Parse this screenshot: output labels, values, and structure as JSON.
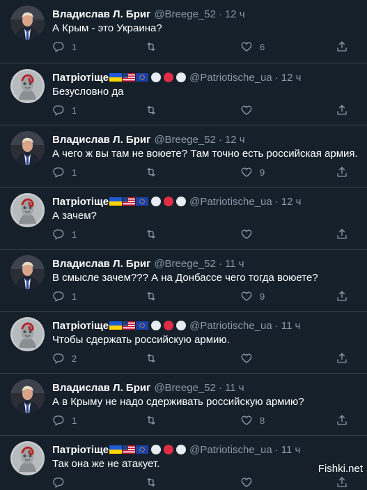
{
  "colors": {
    "background": "#15202b",
    "muted": "#8899a6",
    "divider": "#38444d"
  },
  "tweets": [
    {
      "name": "Владислав Л. Бриг",
      "handle": "@Breege_52",
      "sep": "·",
      "time": "12 ч",
      "text": "А Крым - это Украина?",
      "reply_count": "1",
      "retweet_count": "",
      "like_count": "6",
      "author": "vlad"
    },
    {
      "name": "Патріотіще",
      "handle": "@Patriotische_ua",
      "sep": "·",
      "time": "12 ч",
      "text": "Безусловно да",
      "reply_count": "1",
      "retweet_count": "",
      "like_count": "",
      "author": "patriot"
    },
    {
      "name": "Владислав Л. Бриг",
      "handle": "@Breege_52",
      "sep": "·",
      "time": "12 ч",
      "text": "А чего ж вы там не воюете? Там точно есть российская армия.",
      "reply_count": "1",
      "retweet_count": "",
      "like_count": "9",
      "author": "vlad"
    },
    {
      "name": "Патріотіще",
      "handle": "@Patriotische_ua",
      "sep": "·",
      "time": "12 ч",
      "text": "А зачем?",
      "reply_count": "1",
      "retweet_count": "",
      "like_count": "",
      "author": "patriot"
    },
    {
      "name": "Владислав Л. Бриг",
      "handle": "@Breege_52",
      "sep": "·",
      "time": "11 ч",
      "text": "В смысле зачем??? А на Донбассе чего тогда воюете?",
      "reply_count": "1",
      "retweet_count": "",
      "like_count": "9",
      "author": "vlad"
    },
    {
      "name": "Патріотіще",
      "handle": "@Patriotische_ua",
      "sep": "·",
      "time": "11 ч",
      "text": "Чтобы сдержать российскую армию.",
      "reply_count": "2",
      "retweet_count": "",
      "like_count": "",
      "author": "patriot"
    },
    {
      "name": "Владислав Л. Бриг",
      "handle": "@Breege_52",
      "sep": "·",
      "time": "11 ч",
      "text": "А в Крыму не надо сдерживать российскую армию?",
      "reply_count": "1",
      "retweet_count": "",
      "like_count": "8",
      "author": "vlad"
    },
    {
      "name": "Патріотіще",
      "handle": "@Patriotische_ua",
      "sep": "·",
      "time": "11 ч",
      "text": "Так она же не атакует.",
      "reply_count": "",
      "retweet_count": "",
      "like_count": "",
      "author": "patriot"
    }
  ],
  "patriot_flags": [
    "ukraine-flag",
    "usa-flag",
    "eu-flag",
    "white-circle",
    "red-circle",
    "white-circle"
  ],
  "icons": {
    "reply": "reply-icon",
    "retweet": "retweet-icon",
    "like": "heart-icon",
    "share": "share-icon"
  },
  "watermark": "Fishki.net"
}
